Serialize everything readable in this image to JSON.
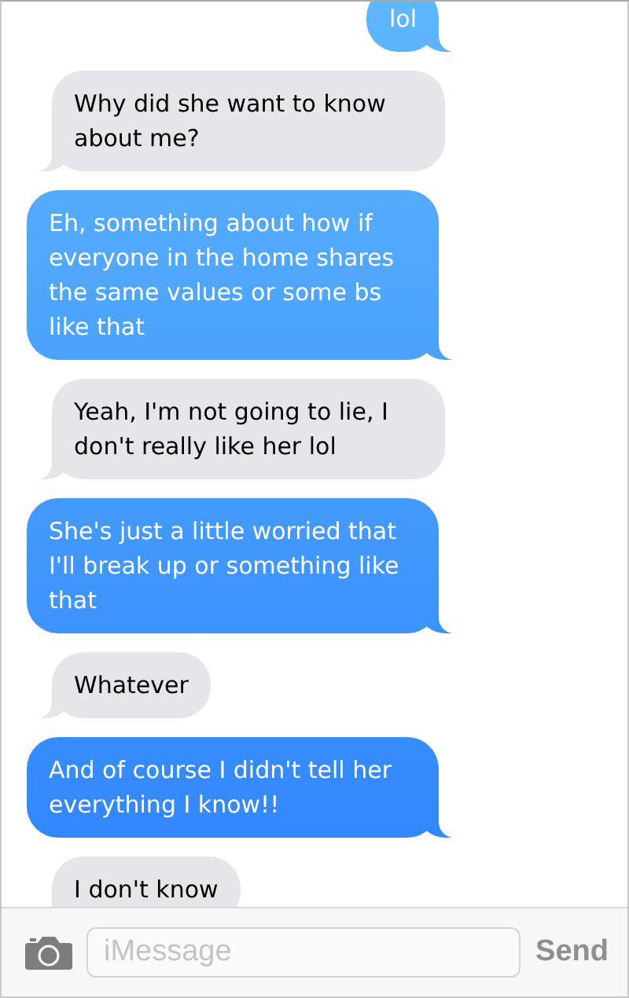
{
  "messages": [
    {
      "kind": "sent",
      "text": "lol"
    },
    {
      "kind": "received",
      "text": "Why did she want to know about me?"
    },
    {
      "kind": "sent",
      "text": "Eh, something about how if everyone in the home shares the same values or some bs like that"
    },
    {
      "kind": "received",
      "text": "Yeah, I'm not going to lie, I don't really like her lol"
    },
    {
      "kind": "sent",
      "text": "She's just a little worried that I'll break up or something like that"
    },
    {
      "kind": "received",
      "text": "Whatever"
    },
    {
      "kind": "sent",
      "text": "And of course I didn't tell her everything I know!!"
    },
    {
      "kind": "received",
      "text": "I don't know"
    }
  ],
  "composer": {
    "placeholder": "iMessage",
    "send": "Send"
  }
}
